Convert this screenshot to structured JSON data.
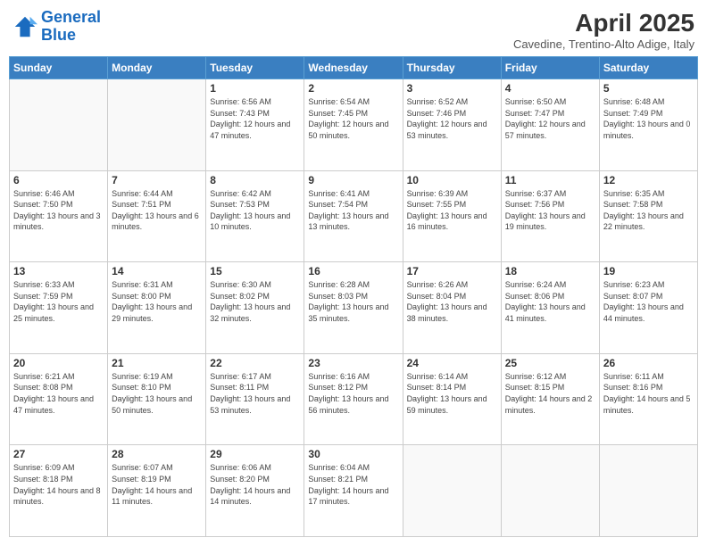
{
  "logo": {
    "line1": "General",
    "line2": "Blue"
  },
  "title": "April 2025",
  "subtitle": "Cavedine, Trentino-Alto Adige, Italy",
  "days_of_week": [
    "Sunday",
    "Monday",
    "Tuesday",
    "Wednesday",
    "Thursday",
    "Friday",
    "Saturday"
  ],
  "weeks": [
    [
      {
        "day": "",
        "info": ""
      },
      {
        "day": "",
        "info": ""
      },
      {
        "day": "1",
        "info": "Sunrise: 6:56 AM\nSunset: 7:43 PM\nDaylight: 12 hours and 47 minutes."
      },
      {
        "day": "2",
        "info": "Sunrise: 6:54 AM\nSunset: 7:45 PM\nDaylight: 12 hours and 50 minutes."
      },
      {
        "day": "3",
        "info": "Sunrise: 6:52 AM\nSunset: 7:46 PM\nDaylight: 12 hours and 53 minutes."
      },
      {
        "day": "4",
        "info": "Sunrise: 6:50 AM\nSunset: 7:47 PM\nDaylight: 12 hours and 57 minutes."
      },
      {
        "day": "5",
        "info": "Sunrise: 6:48 AM\nSunset: 7:49 PM\nDaylight: 13 hours and 0 minutes."
      }
    ],
    [
      {
        "day": "6",
        "info": "Sunrise: 6:46 AM\nSunset: 7:50 PM\nDaylight: 13 hours and 3 minutes."
      },
      {
        "day": "7",
        "info": "Sunrise: 6:44 AM\nSunset: 7:51 PM\nDaylight: 13 hours and 6 minutes."
      },
      {
        "day": "8",
        "info": "Sunrise: 6:42 AM\nSunset: 7:53 PM\nDaylight: 13 hours and 10 minutes."
      },
      {
        "day": "9",
        "info": "Sunrise: 6:41 AM\nSunset: 7:54 PM\nDaylight: 13 hours and 13 minutes."
      },
      {
        "day": "10",
        "info": "Sunrise: 6:39 AM\nSunset: 7:55 PM\nDaylight: 13 hours and 16 minutes."
      },
      {
        "day": "11",
        "info": "Sunrise: 6:37 AM\nSunset: 7:56 PM\nDaylight: 13 hours and 19 minutes."
      },
      {
        "day": "12",
        "info": "Sunrise: 6:35 AM\nSunset: 7:58 PM\nDaylight: 13 hours and 22 minutes."
      }
    ],
    [
      {
        "day": "13",
        "info": "Sunrise: 6:33 AM\nSunset: 7:59 PM\nDaylight: 13 hours and 25 minutes."
      },
      {
        "day": "14",
        "info": "Sunrise: 6:31 AM\nSunset: 8:00 PM\nDaylight: 13 hours and 29 minutes."
      },
      {
        "day": "15",
        "info": "Sunrise: 6:30 AM\nSunset: 8:02 PM\nDaylight: 13 hours and 32 minutes."
      },
      {
        "day": "16",
        "info": "Sunrise: 6:28 AM\nSunset: 8:03 PM\nDaylight: 13 hours and 35 minutes."
      },
      {
        "day": "17",
        "info": "Sunrise: 6:26 AM\nSunset: 8:04 PM\nDaylight: 13 hours and 38 minutes."
      },
      {
        "day": "18",
        "info": "Sunrise: 6:24 AM\nSunset: 8:06 PM\nDaylight: 13 hours and 41 minutes."
      },
      {
        "day": "19",
        "info": "Sunrise: 6:23 AM\nSunset: 8:07 PM\nDaylight: 13 hours and 44 minutes."
      }
    ],
    [
      {
        "day": "20",
        "info": "Sunrise: 6:21 AM\nSunset: 8:08 PM\nDaylight: 13 hours and 47 minutes."
      },
      {
        "day": "21",
        "info": "Sunrise: 6:19 AM\nSunset: 8:10 PM\nDaylight: 13 hours and 50 minutes."
      },
      {
        "day": "22",
        "info": "Sunrise: 6:17 AM\nSunset: 8:11 PM\nDaylight: 13 hours and 53 minutes."
      },
      {
        "day": "23",
        "info": "Sunrise: 6:16 AM\nSunset: 8:12 PM\nDaylight: 13 hours and 56 minutes."
      },
      {
        "day": "24",
        "info": "Sunrise: 6:14 AM\nSunset: 8:14 PM\nDaylight: 13 hours and 59 minutes."
      },
      {
        "day": "25",
        "info": "Sunrise: 6:12 AM\nSunset: 8:15 PM\nDaylight: 14 hours and 2 minutes."
      },
      {
        "day": "26",
        "info": "Sunrise: 6:11 AM\nSunset: 8:16 PM\nDaylight: 14 hours and 5 minutes."
      }
    ],
    [
      {
        "day": "27",
        "info": "Sunrise: 6:09 AM\nSunset: 8:18 PM\nDaylight: 14 hours and 8 minutes."
      },
      {
        "day": "28",
        "info": "Sunrise: 6:07 AM\nSunset: 8:19 PM\nDaylight: 14 hours and 11 minutes."
      },
      {
        "day": "29",
        "info": "Sunrise: 6:06 AM\nSunset: 8:20 PM\nDaylight: 14 hours and 14 minutes."
      },
      {
        "day": "30",
        "info": "Sunrise: 6:04 AM\nSunset: 8:21 PM\nDaylight: 14 hours and 17 minutes."
      },
      {
        "day": "",
        "info": ""
      },
      {
        "day": "",
        "info": ""
      },
      {
        "day": "",
        "info": ""
      }
    ]
  ]
}
